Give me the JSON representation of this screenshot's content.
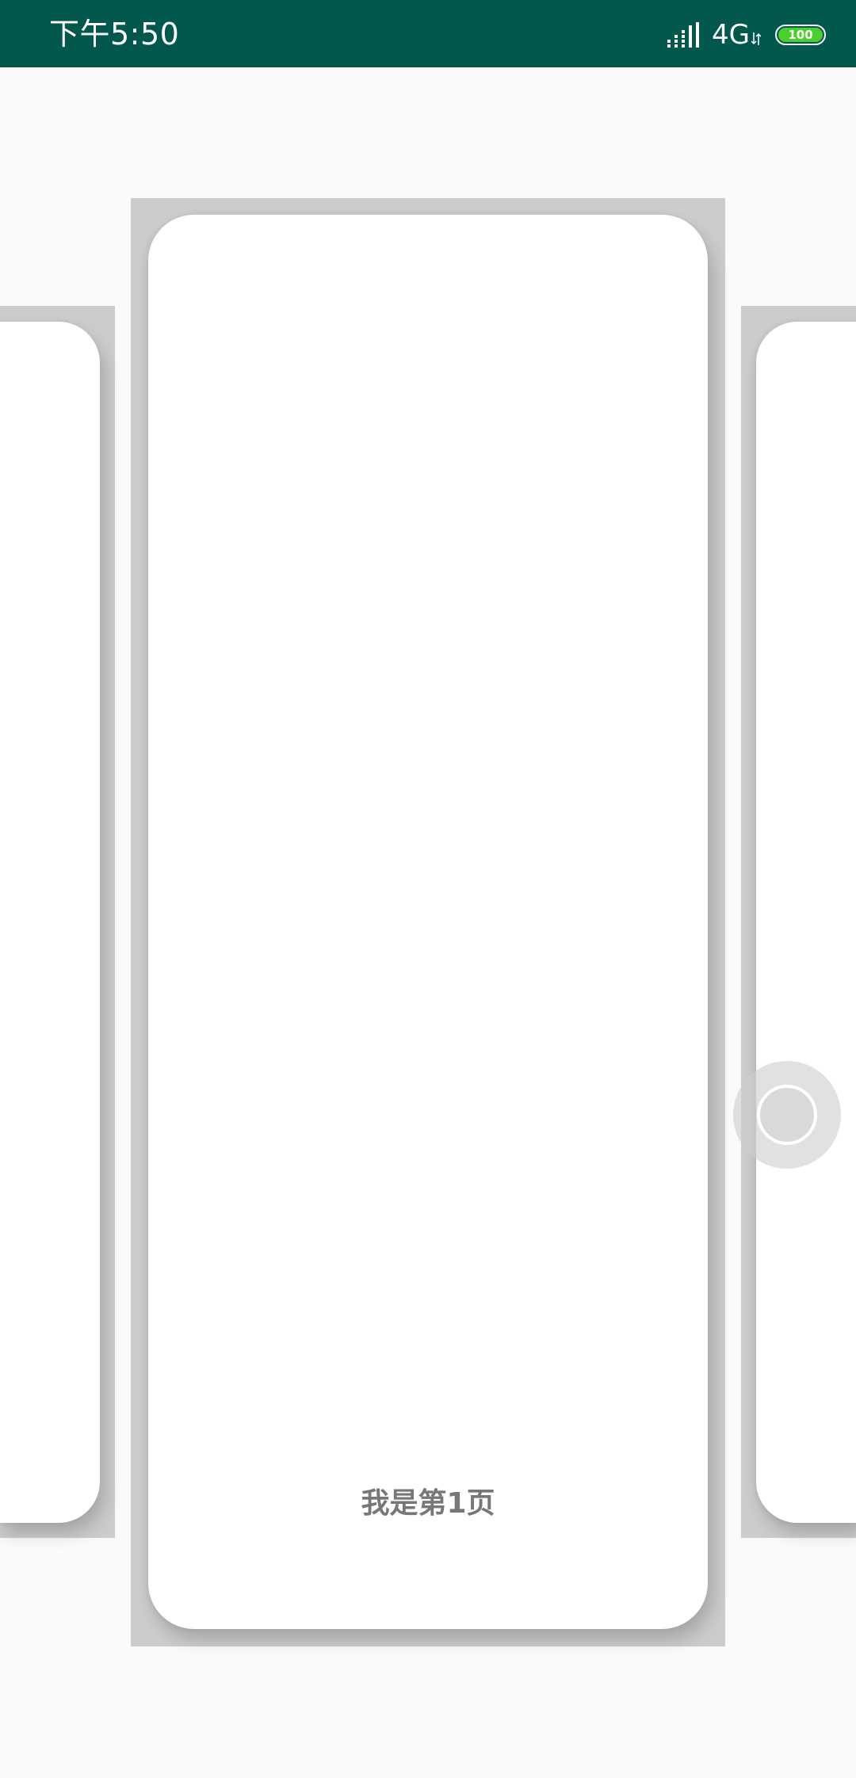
{
  "status_bar": {
    "time": "下午5:50",
    "network": "4G",
    "battery_level": "100",
    "icons": [
      "signal-icon",
      "data-arrows-icon",
      "battery-icon"
    ],
    "background_color": "#02584c",
    "battery_color": "#49d02c"
  },
  "pager": {
    "current_page_label": "我是第1页",
    "cards": [
      "left-card-partial",
      "center-card",
      "right-card-partial"
    ]
  },
  "float_button": {
    "icon": "assistive-touch-icon"
  }
}
